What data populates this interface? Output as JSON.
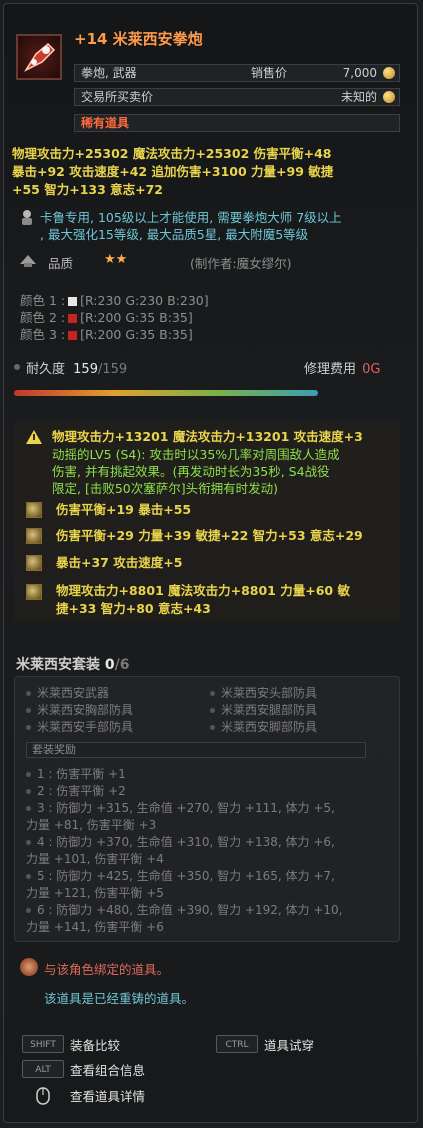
{
  "item": {
    "title": "+14 米莱西安拳炮",
    "type": "拳炮, 武器",
    "sell_label": "销售价",
    "sell_value": "7,000",
    "trade_label": "交易所买卖价",
    "trade_value": "未知的",
    "rarity": "稀有道具"
  },
  "base_stats": [
    "物理攻击力+25302 魔法攻击力+25302 伤害平衡+48",
    "暴击+92 攻击速度+42 追加伤害+3100 力量+99 敏捷",
    "+55 智力+133 意志+72"
  ],
  "requirement": [
    "卡鲁专用, 105级以上才能使用, 需要拳炮大师 7级以上",
    ", 最大强化15等级, 最大品质5星, 最大附魔5等级"
  ],
  "quality": {
    "label": "品质",
    "stars": "★★",
    "maker": "(制作者:魔女缪尔)"
  },
  "colors": [
    {
      "label": "颜色 1 :",
      "value": "[R:230 G:230 B:230]",
      "hex": "#e6e6e6"
    },
    {
      "label": "颜色 2 :",
      "value": "[R:200 G:35 B:35]",
      "hex": "#c82323"
    },
    {
      "label": "颜色 3 :",
      "value": "[R:200 G:35 B:35]",
      "hex": "#c82323"
    }
  ],
  "durability": {
    "label": "耐久度",
    "current": "159",
    "max": "/159",
    "repair_label": "修理费用",
    "repair_value": "0G",
    "fill_fraction": 1.0
  },
  "enchants": [
    {
      "lines": [
        "物理攻击力+13201 魔法攻击力+13201 攻击速度+3"
      ],
      "effect_lines": [
        "动摇的LV5 (S4): 攻击时以35%几率对周围敌人造成",
        "伤害, 并有挑起效果。(再发动时长为35秒, S4战役",
        "限定, [击败50次塞萨尔]头衔拥有时发动)"
      ]
    },
    {
      "lines": [
        "伤害平衡+19 暴击+55"
      ]
    },
    {
      "lines": [
        "伤害平衡+29 力量+39 敏捷+22 智力+53 意志+29"
      ]
    },
    {
      "lines": [
        "暴击+37 攻击速度+5"
      ]
    },
    {
      "lines": [
        "物理攻击力+8801 魔法攻击力+8801 力量+60 敏",
        "捷+33 智力+80 意志+43"
      ]
    }
  ],
  "set": {
    "title": "米莱西安套装",
    "count": "0",
    "total": "/6",
    "pieces": [
      "米莱西安武器",
      "米莱西安头部防具",
      "米莱西安胸部防具",
      "米莱西安腿部防具",
      "米莱西安手部防具",
      "米莱西安脚部防具"
    ],
    "bonus_header": "套装奖励",
    "bonuses": [
      "1 : 伤害平衡 +1",
      "2 : 伤害平衡 +2",
      "3 : 防御力 +315, 生命值 +270, 智力 +111, 体力 +5,",
      "力量 +81, 伤害平衡 +3",
      "4 : 防御力 +370, 生命值 +310, 智力 +138, 体力 +6,",
      "力量 +101, 伤害平衡 +4",
      "5 : 防御力 +425, 生命值 +350, 智力 +165, 体力 +7,",
      "力量 +121, 伤害平衡 +5",
      "6 : 防御力 +480, 生命值 +390, 智力 +192, 体力 +10,",
      "力量 +141, 伤害平衡 +6"
    ]
  },
  "binding": {
    "bound": "与该角色绑定的道具。",
    "reforged": "该道具是已经重铸的道具。"
  },
  "hints": {
    "shift_key": "SHIFT",
    "shift_label": "装备比较",
    "ctrl_key": "CTRL",
    "ctrl_label": "道具试穿",
    "alt_key": "ALT",
    "alt_label": "查看组合信息",
    "mouse_label": "查看道具详情"
  }
}
